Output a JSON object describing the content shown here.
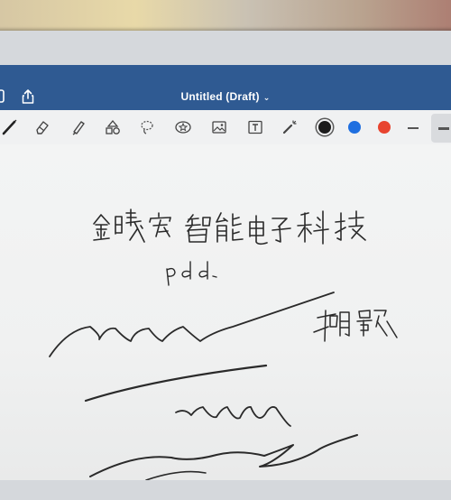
{
  "app": {
    "title": "Untitled (Draft)",
    "title_caret": "⌄"
  },
  "toolbar": {
    "tools": [
      "pen-icon",
      "eraser-icon",
      "highlighter-icon",
      "shapes-icon",
      "lasso-icon",
      "sticker-icon",
      "image-icon",
      "text-icon",
      "laser-pointer-icon"
    ],
    "colors": [
      "#1b1b1b",
      "#1f6fe0",
      "#e8442f"
    ],
    "selected_color": "#1b1b1b"
  },
  "canvas": {
    "handwriting_line1": "金曦宏智能电子科技",
    "handwriting_line2": "pdd.",
    "handwriting_signature": "胡歌"
  },
  "colors": {
    "title_bar": "#2f5a92",
    "ink": "#2a2a2a"
  }
}
